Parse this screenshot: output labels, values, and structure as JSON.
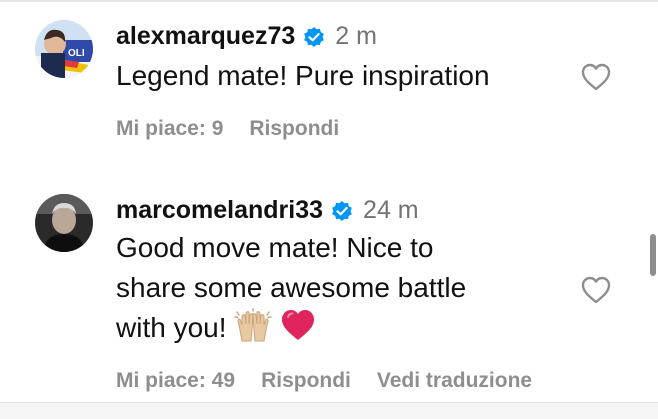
{
  "comments": [
    {
      "username": "alexmarquez73",
      "time": "2 m",
      "text": "Legend mate! Pure inspiration",
      "likes_label": "Mi piace: 9",
      "reply_label": "Rispondi",
      "verified": true
    },
    {
      "username": "marcomelandri33",
      "time": "24 m",
      "text_lines": [
        "Good move mate! Nice to",
        "share some awesome battle",
        "with you!"
      ],
      "emojis": [
        "raising-hands-emoji",
        "red-heart-emoji"
      ],
      "likes_label": "Mi piace: 49",
      "reply_label": "Rispondi",
      "translate_label": "Vedi traduzione",
      "verified": true
    }
  ],
  "icons": {
    "verified": "verified-badge-icon",
    "like": "heart-outline-icon"
  },
  "colors": {
    "verified_blue": "#0095f6",
    "muted_text": "#8e8e8e",
    "time_text": "#737373",
    "heart_emoji": "#e0245e",
    "hands_emoji": "#e8c9a2"
  }
}
